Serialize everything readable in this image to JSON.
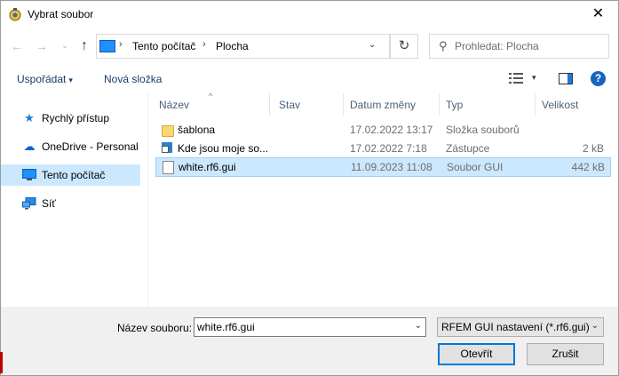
{
  "window": {
    "title": "Vybrat soubor",
    "close_glyph": "✕"
  },
  "nav": {
    "back_glyph": "←",
    "forward_glyph": "→",
    "recent_glyph": "⌄",
    "up_glyph": "↑",
    "breadcrumbs": [
      "Tento počítač",
      "Plocha"
    ],
    "separator_glyph": "›",
    "address_dropdown_glyph": "⌄",
    "refresh_glyph": "↻",
    "search_placeholder": "Prohledat: Plocha",
    "search_glyph": "⚲"
  },
  "toolbar": {
    "organize_label": "Uspořádat",
    "organize_caret": "▾",
    "new_folder_label": "Nová složka",
    "view_dropdown_glyph": "▾",
    "help_glyph": "?"
  },
  "sidebar": {
    "items": [
      {
        "label": "Rychlý přístup",
        "icon": "star-icon",
        "glyph": "★",
        "color": "#1e7ad6",
        "selected": false
      },
      {
        "label": "OneDrive - Personal",
        "icon": "cloud-icon",
        "glyph": "☁",
        "color": "#0a64c8",
        "selected": false
      },
      {
        "label": "Tento počítač",
        "icon": "monitor-icon",
        "glyph": "",
        "color": "#1e7ad6",
        "selected": true
      },
      {
        "label": "Síť",
        "icon": "network-icon",
        "glyph": "",
        "color": "#1e7ad6",
        "selected": false
      }
    ]
  },
  "columns": [
    "Název",
    "Stav",
    "Datum změny",
    "Typ",
    "Velikost"
  ],
  "sort_glyph": "^",
  "files": [
    {
      "name": "šablona",
      "date": "17.02.2022 13:17",
      "type": "Složka souborů",
      "size": "",
      "icon": "folder-icon",
      "selected": false
    },
    {
      "name": "Kde jsou moje so...",
      "date": "17.02.2022 7:18",
      "type": "Zástupce",
      "size": "2 kB",
      "icon": "shortcut-icon",
      "selected": false
    },
    {
      "name": "white.rf6.gui",
      "date": "11.09.2023 11:08",
      "type": "Soubor GUI",
      "size": "442 kB",
      "icon": "file-icon",
      "selected": true
    }
  ],
  "bottom": {
    "filename_label": "Název souboru:",
    "filename_value": "white.rf6.gui",
    "filename_dropdown_glyph": "⌄",
    "filetype_value": "RFEM GUI nastavení (*.rf6.gui)",
    "filetype_dropdown_glyph": "⌄",
    "open_label": "Otevřít",
    "cancel_label": "Zrušit"
  },
  "colors": {
    "selection": "#cce8ff",
    "accent": "#0078d7",
    "link": "#1a3a6a"
  }
}
